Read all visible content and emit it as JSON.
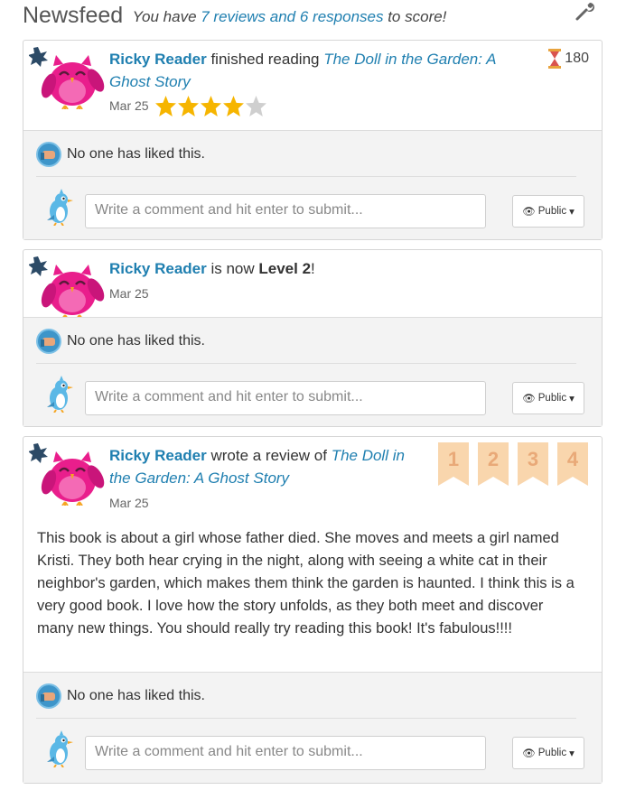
{
  "header": {
    "title": "Newsfeed",
    "sub_prefix": "You have ",
    "sub_link": "7 reviews and 6 responses",
    "sub_suffix": " to score!",
    "wrench_icon": "wrench-icon"
  },
  "colors": {
    "link": "#1f7fb0",
    "owl": "#e91e8c",
    "ribbon": "#f9d6ad",
    "panel": "#f3f3f3"
  },
  "posts": [
    {
      "user": "Ricky Reader",
      "action": " finished reading ",
      "book": "The Doll in the Garden: A Ghost Story",
      "date": "Mar 25",
      "rating": 4,
      "rating_max": 5,
      "timer_value": "180",
      "likes_text": "No one has liked this.",
      "comment_placeholder": "Write a comment and hit enter to submit...",
      "visibility": "Public"
    },
    {
      "user": "Ricky Reader",
      "action": " is now ",
      "level": "Level 2",
      "suffix": "!",
      "date": "Mar 25",
      "likes_text": "No one has liked this.",
      "comment_placeholder": "Write a comment and hit enter to submit...",
      "visibility": "Public"
    },
    {
      "user": "Ricky Reader",
      "action": " wrote a review of ",
      "book": "The Doll in the Garden: A Ghost Story",
      "date": "Mar 25",
      "score_ribbons": [
        "1",
        "2",
        "3",
        "4"
      ],
      "review": "This book is about a girl whose father died. She moves and meets a girl named Kristi. They both hear crying in the night, along with seeing a white cat in their neighbor's garden, which makes them think the garden is haunted. I think this is a very good book. I love how the story unfolds, as they both meet and discover many new things. You should really try reading this book! It's fabulous!!!!",
      "likes_text": "No one has liked this.",
      "comment_placeholder": "Write a comment and hit enter to submit...",
      "visibility": "Public"
    }
  ]
}
